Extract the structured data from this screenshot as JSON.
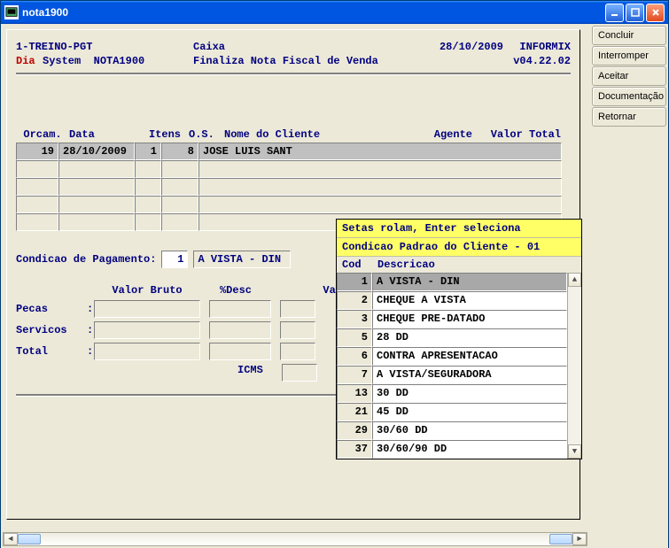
{
  "window": {
    "title": "nota1900"
  },
  "sidebar": {
    "items": [
      {
        "label": "Concluir"
      },
      {
        "label": "Interromper"
      },
      {
        "label": "Aceitar"
      },
      {
        "label": "Documentação"
      },
      {
        "label": "Retornar"
      }
    ]
  },
  "header": {
    "org": "1-TREINO-PGT",
    "module": "Caixa",
    "date": "28/10/2009",
    "db": "INFORMIX",
    "dia": "Dia",
    "system": "System",
    "program": "NOTA1900",
    "description": "Finaliza Nota Fiscal de Venda",
    "version": "v04.22.02"
  },
  "grid": {
    "headers": {
      "orcam": "Orcam.",
      "data": "Data",
      "itens": "Itens",
      "os": "O.S.",
      "nome": "Nome do Cliente",
      "agente": "Agente",
      "valor": "Valor Total"
    },
    "rows": [
      {
        "orcam": "19",
        "data": "28/10/2009",
        "itens": "1",
        "os": "8",
        "nome": "JOSE LUIS SANT"
      }
    ]
  },
  "condicao": {
    "label": "Condicao de Pagamento:",
    "code": "1",
    "desc": "A VISTA - DIN"
  },
  "totals": {
    "headers": {
      "bruto": "Valor Bruto",
      "desc": "%Desc",
      "liq": "Val"
    },
    "rows": [
      {
        "label": "Pecas",
        "sep": ":"
      },
      {
        "label": "Servicos",
        "sep": ":"
      },
      {
        "label": "Total",
        "sep": ":"
      }
    ],
    "icms_label": "ICMS"
  },
  "popup": {
    "hint1": "Setas rolam, Enter seleciona",
    "hint2": "Condicao Padrao do Cliente - 01",
    "col_cod": "Cod",
    "col_desc": "Descricao",
    "options": [
      {
        "cod": "1",
        "desc": "A VISTA - DIN"
      },
      {
        "cod": "2",
        "desc": "CHEQUE A VISTA"
      },
      {
        "cod": "3",
        "desc": "CHEQUE PRE-DATADO"
      },
      {
        "cod": "5",
        "desc": "28 DD"
      },
      {
        "cod": "6",
        "desc": "CONTRA APRESENTACAO"
      },
      {
        "cod": "7",
        "desc": "A VISTA/SEGURADORA"
      },
      {
        "cod": "13",
        "desc": "30 DD"
      },
      {
        "cod": "21",
        "desc": "45 DD"
      },
      {
        "cod": "29",
        "desc": "30/60 DD"
      },
      {
        "cod": "37",
        "desc": "30/60/90 DD"
      }
    ],
    "selected_index": 0
  }
}
